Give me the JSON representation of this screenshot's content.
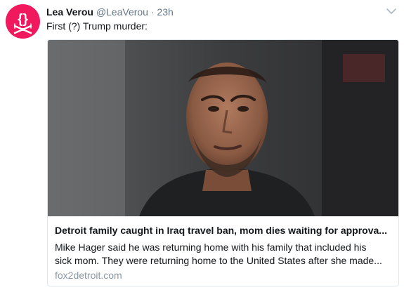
{
  "author": {
    "name": "Lea Verou",
    "handle": "@LeaVerou",
    "separator": "·",
    "time": "23h"
  },
  "tweet": {
    "text": "First (?) Trump murder:"
  },
  "card": {
    "title": "Detroit family caught in Iraq travel ban, mom dies waiting for approva...",
    "description_line1": "Mike Hager said he was returning home with his family that included his",
    "description_line2": "sick mom. They were returning home to the United States after she made...",
    "domain": "fox2detroit.com"
  },
  "icons": {
    "avatar": "avatar-logo-icon",
    "caret": "chevron-down-icon"
  },
  "colors": {
    "avatar_bg": "#f0195d",
    "muted": "#657786",
    "text": "#14171a",
    "domain": "#8899a6",
    "border": "#e1e8ed"
  }
}
